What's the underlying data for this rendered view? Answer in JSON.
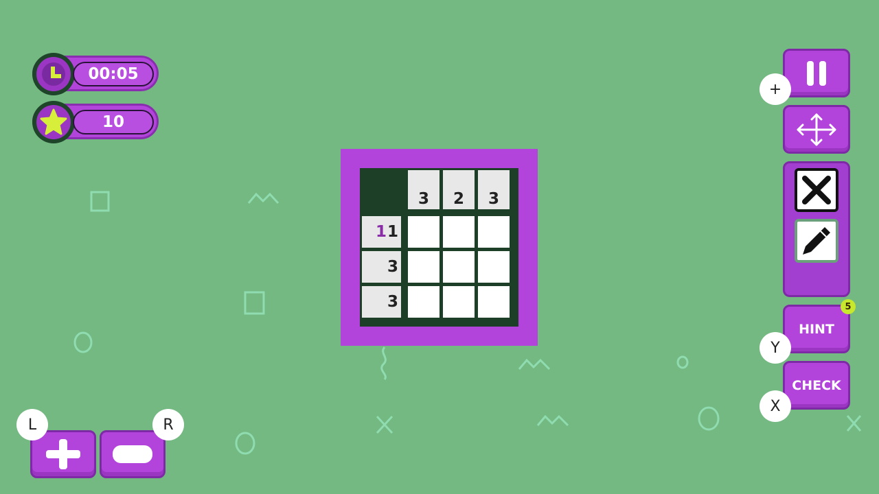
{
  "hud": {
    "timer": "00:05",
    "score": "10",
    "timer_icon": "clock-icon",
    "score_icon": "star-icon"
  },
  "board": {
    "col_clues": [
      "3",
      "2",
      "3"
    ],
    "row_clues": [
      {
        "parts": [
          "1",
          "1"
        ],
        "completed_first": true
      },
      {
        "parts": [
          "3"
        ],
        "completed_first": false
      },
      {
        "parts": [
          "3"
        ],
        "completed_first": false
      }
    ]
  },
  "controls": {
    "pause_key": "+",
    "hint_label": "HINT",
    "hint_count": "5",
    "hint_key": "Y",
    "check_label": "CHECK",
    "check_key": "X",
    "zoom_in_key": "L",
    "zoom_out_key": "R"
  },
  "colors": {
    "background": "#74b882",
    "accent": "#b344db",
    "board": "#1d3f27",
    "star": "#d7ee3a"
  }
}
